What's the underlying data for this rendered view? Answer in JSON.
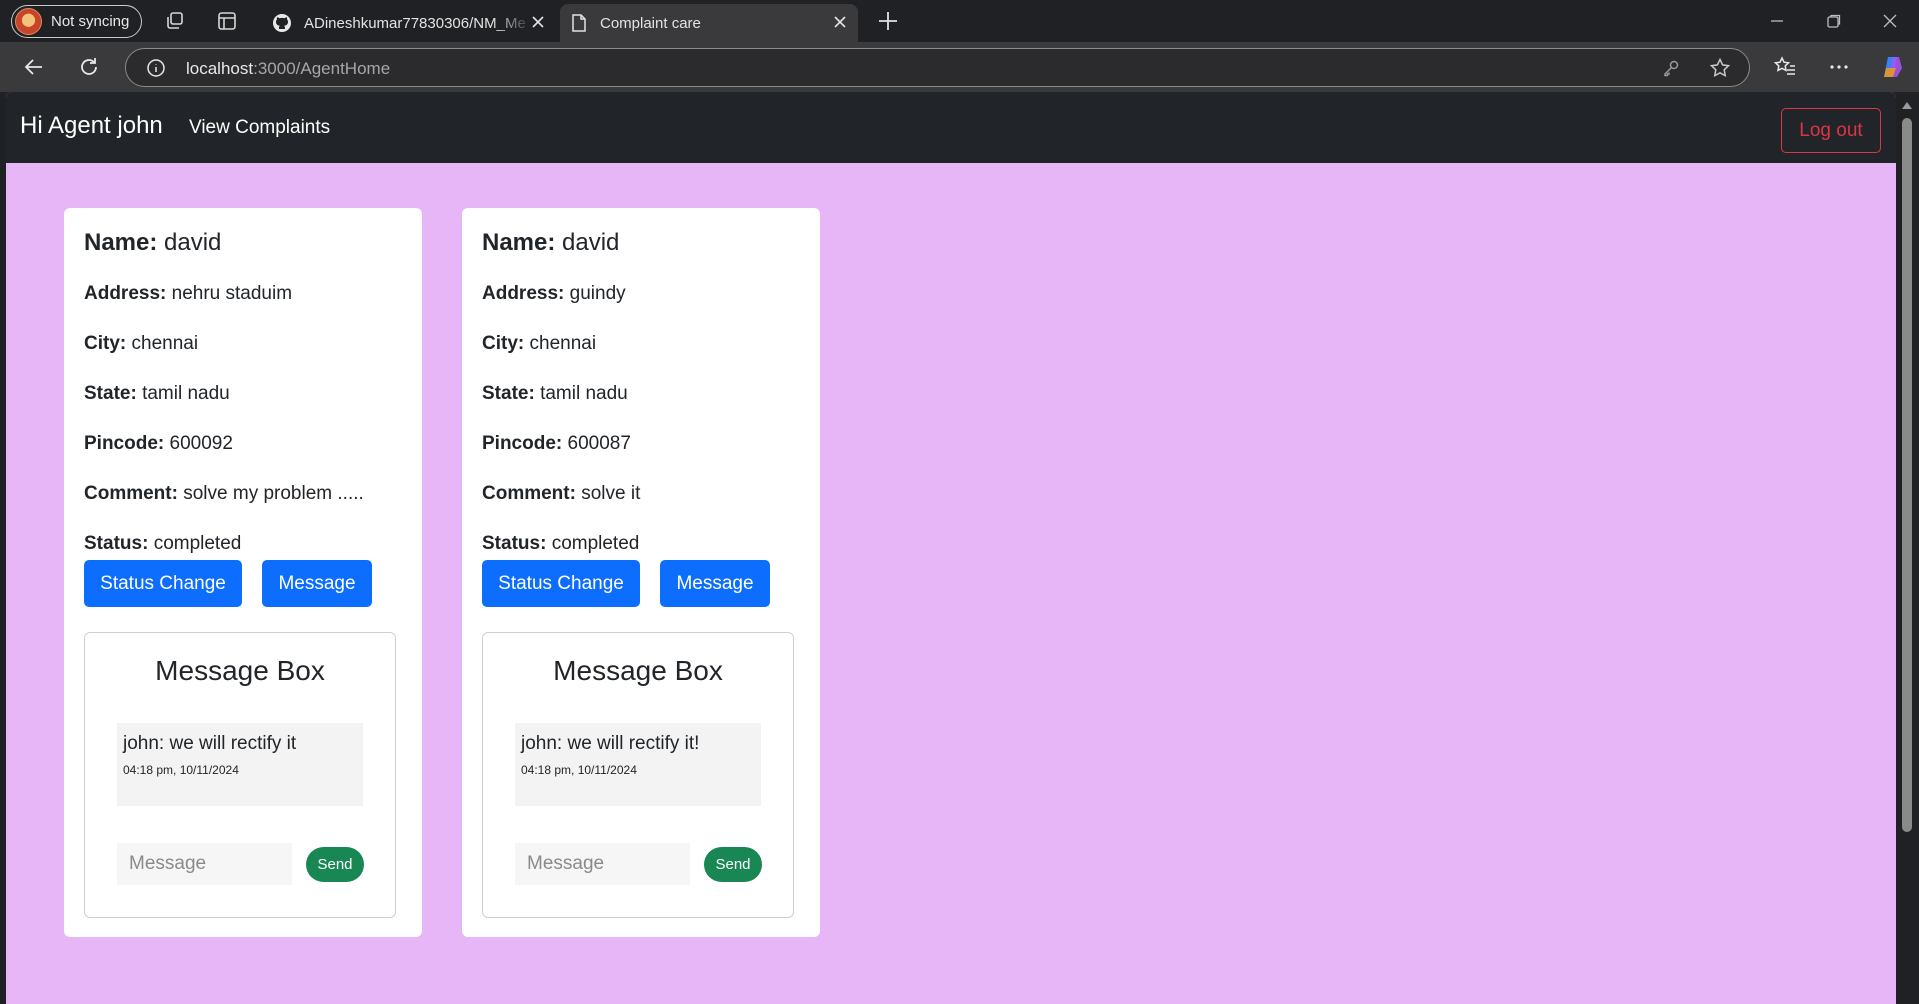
{
  "browser": {
    "profile_label": "Not syncing",
    "tabs": [
      {
        "title": "ADineshkumar77830306/NM_Me",
        "active": false
      },
      {
        "title": "Complaint care",
        "active": true
      }
    ],
    "url_host": "localhost",
    "url_rest": ":3000/AgentHome"
  },
  "navbar": {
    "brand": "Hi Agent john",
    "link": "View Complaints",
    "logout": "Log out"
  },
  "labels": {
    "name": "Name:",
    "address": "Address:",
    "city": "City:",
    "state": "State:",
    "pincode": "Pincode:",
    "comment": "Comment:",
    "status": "Status:",
    "status_change": "Status Change",
    "message": "Message",
    "message_box": "Message Box",
    "message_placeholder": "Message",
    "send": "Send"
  },
  "complaints": [
    {
      "name": "david",
      "address": "nehru staduim",
      "city": "chennai",
      "state": "tamil nadu",
      "pincode": "600092",
      "comment": "solve my problem .....",
      "status": "completed",
      "messages": [
        {
          "text": "john: we will rectify it",
          "time": "04:18 pm, 10/11/2024"
        }
      ]
    },
    {
      "name": "david",
      "address": "guindy",
      "city": "chennai",
      "state": "tamil nadu",
      "pincode": "600087",
      "comment": "solve it",
      "status": "completed",
      "messages": [
        {
          "text": "john: we will rectify it!",
          "time": "04:18 pm, 10/11/2024"
        }
      ]
    }
  ],
  "colors": {
    "page_bg": "#e6b6f6",
    "navbar_bg": "#212529",
    "primary": "#0d6efd",
    "success": "#198754",
    "danger": "#dc3545"
  }
}
